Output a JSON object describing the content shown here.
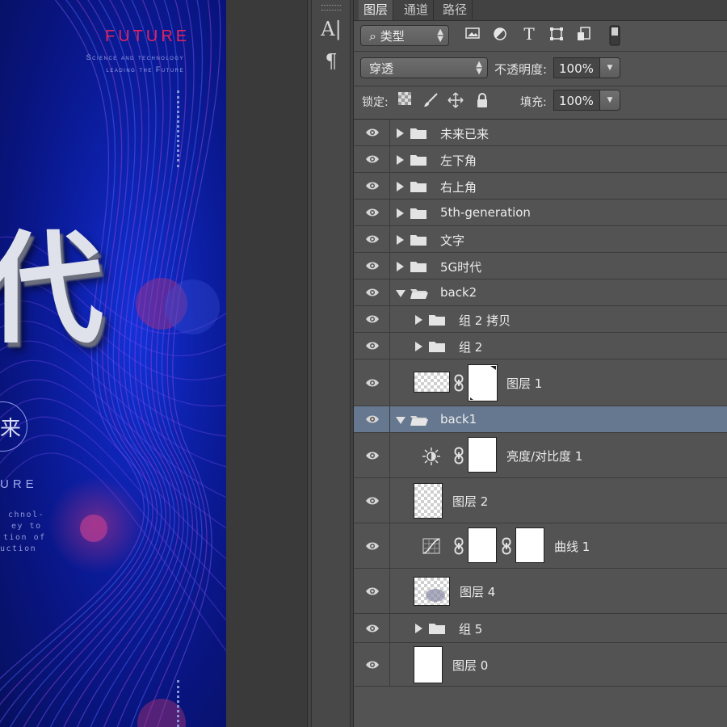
{
  "canvas": {
    "title": "FUTURE",
    "subtitle_lines": [
      "Science and technology",
      "leading the Future"
    ],
    "big_char": "代",
    "ring_char": "来",
    "side_word": "URE",
    "side_text": [
      "chnol-",
      "ey to",
      "tion of",
      "uction"
    ]
  },
  "toolstrip": {
    "icons": [
      "character-panel-icon",
      "paragraph-panel-icon"
    ],
    "char_icon": "A|",
    "para_icon": "¶"
  },
  "tabs": [
    "图层",
    "通道",
    "路径"
  ],
  "filter": {
    "kind_label": "类型",
    "search_glyph": "⌕"
  },
  "blend": {
    "mode": "穿透",
    "opacity_label": "不透明度:",
    "opacity_value": "100%"
  },
  "lock": {
    "label": "锁定:",
    "fill_label": "填充:",
    "fill_value": "100%"
  },
  "layers": [
    {
      "name": "未来已来",
      "type": "group",
      "expanded": false,
      "indent": 0
    },
    {
      "name": "左下角",
      "type": "group",
      "expanded": false,
      "indent": 0
    },
    {
      "name": "右上角",
      "type": "group",
      "expanded": false,
      "indent": 0
    },
    {
      "name": "5th-generation",
      "type": "group",
      "expanded": false,
      "indent": 0
    },
    {
      "name": "文字",
      "type": "group",
      "expanded": false,
      "indent": 0
    },
    {
      "name": "5G时代",
      "type": "group",
      "expanded": false,
      "indent": 0
    },
    {
      "name": "back2",
      "type": "group",
      "expanded": true,
      "indent": 0
    },
    {
      "name": "组 2 拷贝",
      "type": "group",
      "expanded": false,
      "indent": 1
    },
    {
      "name": "组 2",
      "type": "group",
      "expanded": false,
      "indent": 1
    },
    {
      "name": "图层 1",
      "type": "masked-layer",
      "indent": 1
    },
    {
      "name": "back1",
      "type": "group",
      "expanded": true,
      "indent": 0,
      "selected": true
    },
    {
      "name": "亮度/对比度 1",
      "type": "adjustment-brightness",
      "indent": 1
    },
    {
      "name": "图层 2",
      "type": "layer",
      "indent": 1
    },
    {
      "name": "曲线 1",
      "type": "adjustment-curves",
      "indent": 1
    },
    {
      "name": "图层 4",
      "type": "layer",
      "indent": 1
    },
    {
      "name": "组 5",
      "type": "group",
      "expanded": false,
      "indent": 1
    },
    {
      "name": "图层 0",
      "type": "white-layer",
      "indent": 1
    }
  ],
  "colors": {
    "panel_bg": "#535353",
    "selected_row": "#66788f",
    "poster_accent": "#e0245e",
    "poster_bg": "#0c1fa6"
  }
}
